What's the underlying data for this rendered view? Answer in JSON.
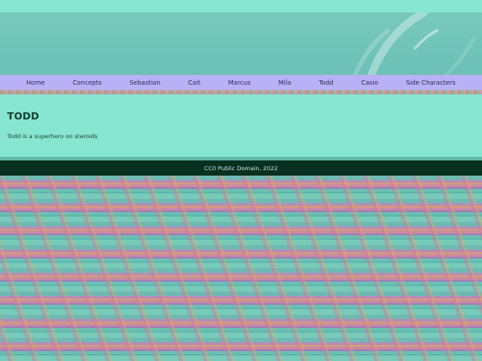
{
  "nav": {
    "items": [
      {
        "label": "Home"
      },
      {
        "label": "Concepts"
      },
      {
        "label": "Sebastian"
      },
      {
        "label": "Cait"
      },
      {
        "label": "Marcus"
      },
      {
        "label": "Mila"
      },
      {
        "label": "Todd"
      },
      {
        "label": "Casio"
      },
      {
        "label": "Side Characters"
      }
    ]
  },
  "main": {
    "title": "TODD",
    "text": "Todd is a superhero on steroids"
  },
  "footer": {
    "text": "CC0 Public Domain, 2022"
  },
  "colors": {
    "background_teal": "#86e6d0",
    "nav_bar": "#b9b0f5",
    "footer_bg": "#073021",
    "banner": "#6cc0b6"
  }
}
